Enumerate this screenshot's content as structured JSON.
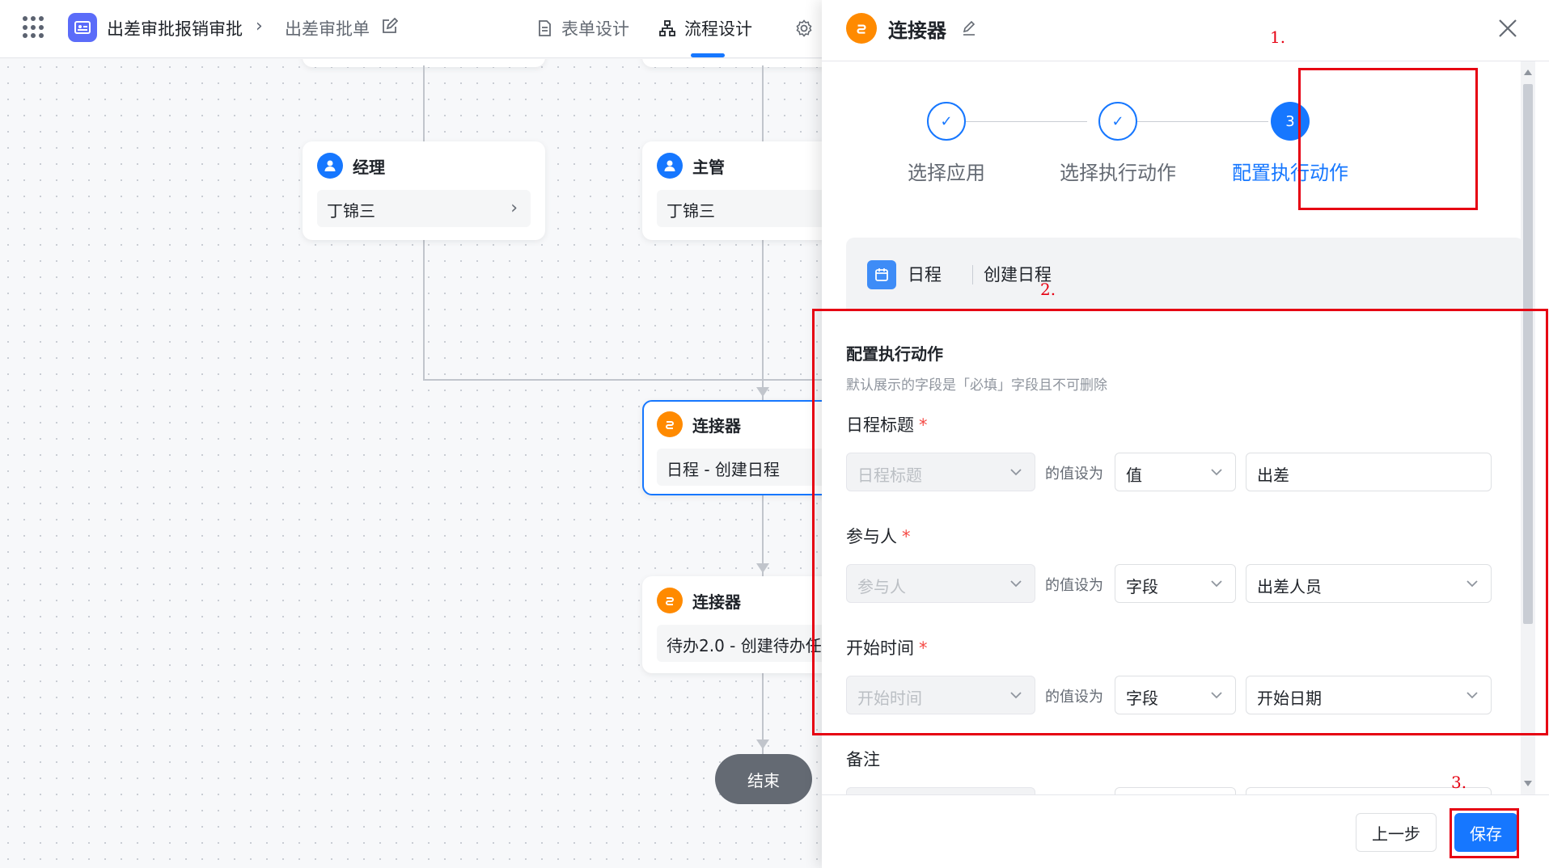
{
  "topbar": {
    "app_title": "出差审批报销审批",
    "crumb_sub": "出差审批单",
    "tabs": [
      {
        "label": "表单设计",
        "icon": "document-icon"
      },
      {
        "label": "流程设计",
        "icon": "flow-icon"
      }
    ],
    "active_tab": "流程设计"
  },
  "canvas": {
    "nodes": {
      "manager": {
        "title": "经理",
        "value": "丁锦三"
      },
      "supervisor": {
        "title": "主管",
        "value": "丁锦三"
      },
      "connector1": {
        "title": "连接器",
        "value": "日程 - 创建日程"
      },
      "connector2": {
        "title": "连接器",
        "value": "待办2.0 - 创建待办任"
      }
    },
    "end_label": "结束"
  },
  "drawer": {
    "title": "连接器",
    "steps": [
      {
        "label": "选择应用",
        "state": "done"
      },
      {
        "label": "选择执行动作",
        "state": "done"
      },
      {
        "label": "配置执行动作",
        "state": "current",
        "number": "3"
      }
    ],
    "summary": {
      "app": "日程",
      "action": "创建日程"
    },
    "section_title": "配置执行动作",
    "section_desc": "默认展示的字段是「必填」字段且不可删除",
    "set_text": "的值设为",
    "fields": [
      {
        "label": "日程标题",
        "required": "*",
        "field": "日程标题",
        "mode": "值",
        "value": "出差"
      },
      {
        "label": "参与人",
        "required": "*",
        "field": "参与人",
        "mode": "字段",
        "value": "出差人员"
      },
      {
        "label": "开始时间",
        "required": "*",
        "field": "开始时间",
        "mode": "字段",
        "value": "开始日期"
      }
    ],
    "note_label": "备注",
    "buttons": {
      "prev": "上一步",
      "save": "保存"
    }
  },
  "annotations": {
    "a1": "1.",
    "a2": "2.",
    "a3": "3."
  },
  "colors": {
    "accent": "#1677ff",
    "connector": "#ff8a00",
    "annotation": "#e60012"
  }
}
